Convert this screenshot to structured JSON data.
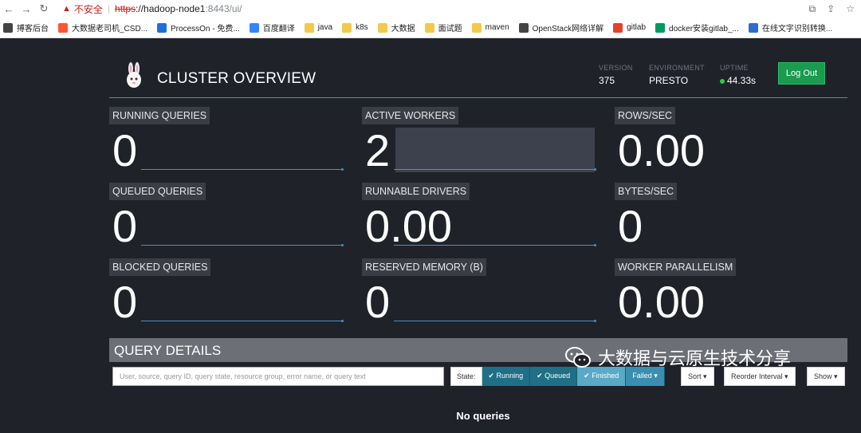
{
  "browser": {
    "insecure_label": "不安全",
    "url_scheme": "https",
    "url_host": "://hadoop-node1",
    "url_path": ":8443/ui/"
  },
  "bookmarks": [
    {
      "label": "搏客后台",
      "icon": "blog-icon",
      "color": "#444444"
    },
    {
      "label": "大数据老司机_CSD...",
      "icon": "csdn-icon",
      "color": "#fc5531"
    },
    {
      "label": "ProcessOn - 免费...",
      "icon": "processon-icon",
      "color": "#1f6fd8"
    },
    {
      "label": "百度翻译",
      "icon": "baidu-translate-icon",
      "color": "#3385ff"
    },
    {
      "label": "java",
      "icon": "folder-icon",
      "color": "#f2c94c"
    },
    {
      "label": "k8s",
      "icon": "folder-icon",
      "color": "#f2c94c"
    },
    {
      "label": "大数据",
      "icon": "folder-icon",
      "color": "#f2c94c"
    },
    {
      "label": "面试题",
      "icon": "folder-icon",
      "color": "#f2c94c"
    },
    {
      "label": "maven",
      "icon": "folder-icon",
      "color": "#f2c94c"
    },
    {
      "label": "OpenStack网络详解",
      "icon": "blog-icon",
      "color": "#444444"
    },
    {
      "label": "gitlab",
      "icon": "gitlab-icon",
      "color": "#e24329"
    },
    {
      "label": "docker安装gitlab_...",
      "icon": "sf-icon",
      "color": "#009a61"
    },
    {
      "label": "在线文字识别转换...",
      "icon": "gear-icon",
      "color": "#2b6cd4"
    }
  ],
  "header": {
    "title": "CLUSTER OVERVIEW",
    "version_label": "VERSION",
    "version_value": "375",
    "environment_label": "ENVIRONMENT",
    "environment_value": "PRESTO",
    "uptime_label": "UPTIME",
    "uptime_value": "44.33s",
    "logout_label": "Log Out"
  },
  "stats": [
    {
      "label": "RUNNING QUERIES",
      "value": "0"
    },
    {
      "label": "ACTIVE WORKERS",
      "value": "2"
    },
    {
      "label": "ROWS/SEC",
      "value": "0.00"
    },
    {
      "label": "QUEUED QUERIES",
      "value": "0"
    },
    {
      "label": "RUNNABLE DRIVERS",
      "value": "0.00"
    },
    {
      "label": "BYTES/SEC",
      "value": "0"
    },
    {
      "label": "BLOCKED QUERIES",
      "value": "0"
    },
    {
      "label": "RESERVED MEMORY (B)",
      "value": "0"
    },
    {
      "label": "WORKER PARALLELISM",
      "value": "0.00"
    }
  ],
  "query_details": {
    "title": "QUERY DETAILS",
    "search_placeholder": "User, source, query ID, query state, resource group, error name, or query text",
    "state_label": "State:",
    "state_running": "✔ Running",
    "state_queued": "✔ Queued",
    "state_finished": "✔ Finished",
    "state_failed": "Failed ▾",
    "sort_label": "Sort ▾",
    "reorder_label": "Reorder Interval ▾",
    "show_label": "Show ▾",
    "empty_text": "No queries"
  },
  "watermark": "大数据与云原生技术分享"
}
